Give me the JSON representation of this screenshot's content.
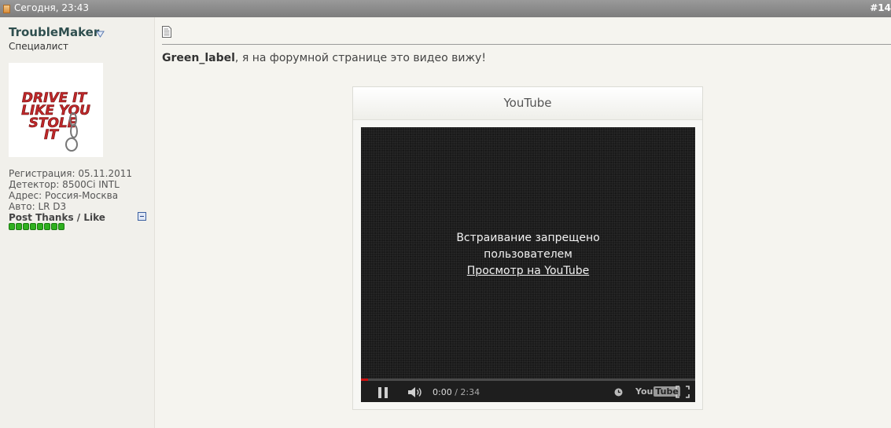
{
  "post": {
    "date": "Сегодня, 23:43",
    "number": "#14"
  },
  "author": {
    "username": "TroubleMaker",
    "title": "Специалист",
    "avatar_text": "DRIVE IT LIKE YOU STOLE IT",
    "registration": "Регистрация: 05.11.2011",
    "detector": "Детектор: 8500Ci INTL",
    "address": "Адрес: Россия-Москва",
    "auto": "Авто: LR D3",
    "thanks_label": "Post Thanks / Like",
    "reputation_pips": 8
  },
  "message": {
    "quoted_user": "Green_label",
    "text": ", я на форумной странице это видео вижу!"
  },
  "video": {
    "provider": "YouTube",
    "embed_line1": "Встраивание запрещено",
    "embed_line2": "пользователем",
    "watch_link": "Просмотр на YouTube",
    "current_time": "0:00",
    "separator": " / ",
    "duration": "2:34",
    "logo_you": "You",
    "logo_tube": "Tube"
  },
  "colors": {
    "topbar": "#8a8a8a",
    "sidebar": "#f1f0eb",
    "reputation": "#2fb01f",
    "progress": "#cc1111"
  }
}
